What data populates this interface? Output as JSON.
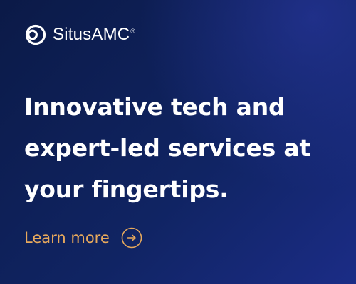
{
  "brand": {
    "name": "SitusAMC",
    "trademark": "®",
    "logo_icon": "ring-logo-icon"
  },
  "headline": {
    "lines": [
      "Innovative tech and",
      "expert-led services at",
      "your fingertips."
    ]
  },
  "cta": {
    "label": "Learn more",
    "icon": "arrow-right-circle-icon"
  },
  "colors": {
    "background_dark": "#0b1a47",
    "background_light": "#1b2c86",
    "text": "#ffffff",
    "accent": "#e7a95c"
  }
}
